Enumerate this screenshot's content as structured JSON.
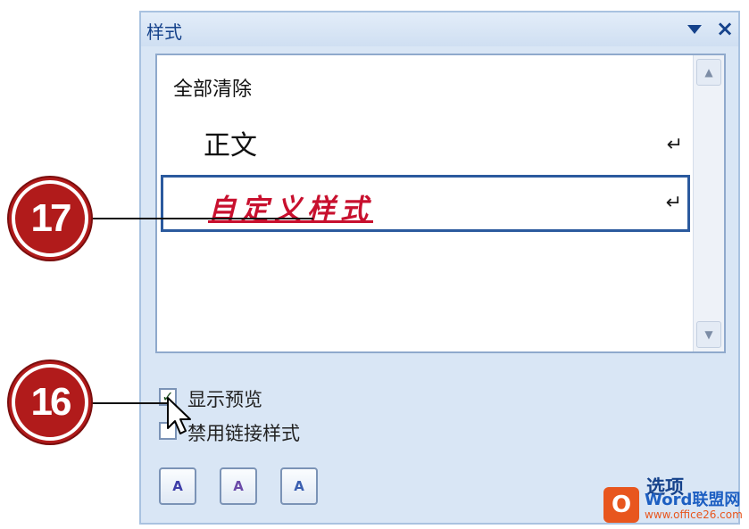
{
  "pane": {
    "title": "样式",
    "dropdown_icon": "triangle-down-icon",
    "close_label": "×"
  },
  "style_list": {
    "items": [
      {
        "label": "全部清除",
        "paragraph_mark": ""
      },
      {
        "label": "正文",
        "paragraph_mark": "↵"
      },
      {
        "label": "自定义样式",
        "paragraph_mark": "↵",
        "selected": true,
        "color": "#c8102e"
      }
    ],
    "scroll_up": "▲",
    "scroll_down": "▼"
  },
  "options": {
    "show_preview": {
      "label": "显示预览",
      "checked": true,
      "mark": "✓"
    },
    "disable_linked": {
      "label": "禁用链接样式",
      "checked": false
    }
  },
  "toolbar": {
    "new_style_icon": "new-style-icon",
    "new_style_glyph": "A",
    "style_inspector_icon": "style-inspector-icon",
    "style_inspector_glyph": "A",
    "manage_styles_icon": "manage-styles-icon",
    "manage_styles_glyph": "A",
    "options_label": "选项"
  },
  "callouts": {
    "step_17": "17",
    "step_16": "16"
  },
  "watermark": {
    "logo_char": "O",
    "title": "Word联盟网",
    "url": "www.office26.com"
  },
  "colors": {
    "pane_bg": "#d9e6f5",
    "title_text": "#15428b",
    "custom_style": "#c8102e",
    "callout": "#b11b1b"
  }
}
